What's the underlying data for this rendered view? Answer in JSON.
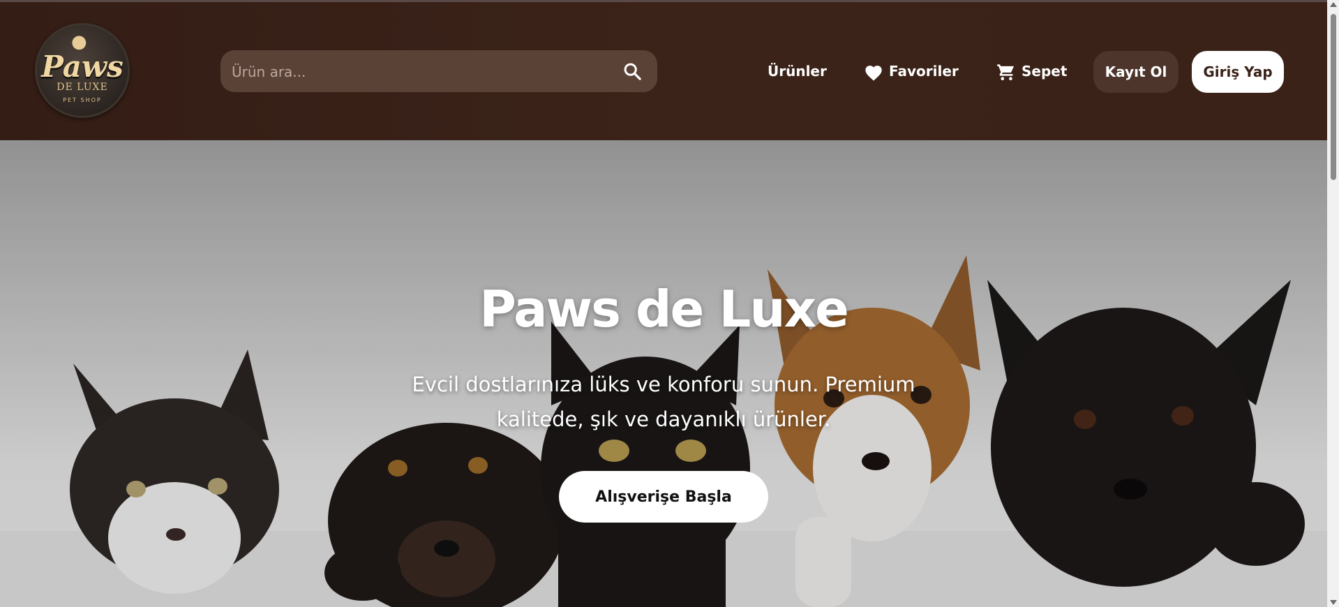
{
  "brand": {
    "logo_main": "Paws",
    "logo_sub": "DE LUXE",
    "logo_tag": "PET SHOP"
  },
  "search": {
    "placeholder": "Ürün ara...",
    "value": "",
    "icon": "search-icon"
  },
  "nav": {
    "products": "Ürünler",
    "favorites": "Favoriler",
    "favorites_icon": "heart-icon",
    "cart": "Sepet",
    "cart_icon": "cart-icon",
    "register": "Kayıt Ol",
    "login": "Giriş Yap"
  },
  "hero": {
    "title": "Paws de Luxe",
    "subtitle": "Evcil dostlarınıza lüks ve konforu sunun. Premium kalitede, şık ve dayanıklı ürünler.",
    "cta": "Alışverişe Başla"
  },
  "colors": {
    "header_bg": "#3a2218",
    "search_bg": "#5b4237",
    "register_bg": "#4d352c",
    "accent_gold": "#e2c590"
  }
}
